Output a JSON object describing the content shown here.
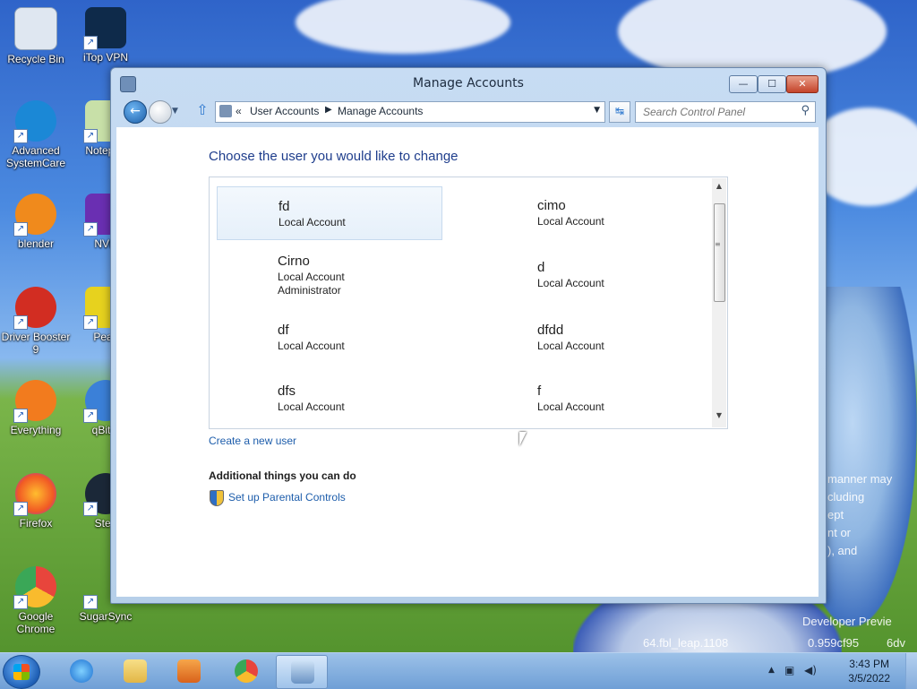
{
  "desktop": {
    "icons": [
      {
        "label": "Recycle Bin",
        "color": "#dfe7f1"
      },
      {
        "label": "iTop VPN",
        "color": "#1aa0c8"
      },
      {
        "label": "Advanced SystemCare",
        "color": "#1b88d6"
      },
      {
        "label": "Notepad",
        "color": "#c8e0a8"
      },
      {
        "label": "blender",
        "color": "#f08a1c"
      },
      {
        "label": "NVD",
        "color": "#6a2fb2"
      },
      {
        "label": "Driver Booster 9",
        "color": "#d22d22"
      },
      {
        "label": "Peaz",
        "color": "#e7d21e"
      },
      {
        "label": "Everything",
        "color": "#f27b1e"
      },
      {
        "label": "qBitto",
        "color": "#3b80d8"
      },
      {
        "label": "Firefox",
        "color": "#f15a24"
      },
      {
        "label": "Stea",
        "color": "#1b2838"
      },
      {
        "label": "Google Chrome",
        "color": "#e8453c"
      },
      {
        "label": "SugarSync",
        "color": "#4a9b2f"
      }
    ],
    "watermark": {
      "line1": "Developer Previe",
      "line2": "64.fbl_leap.1108",
      "line3": "0.959cf95",
      "line4": "6dv",
      "partial1": "manner may",
      "partial2": "cluding",
      "partial3": "ept",
      "partial4": "nt or",
      "partial5": "), and"
    }
  },
  "window": {
    "title": "Manage Accounts",
    "buttons": {
      "minimize": "—",
      "maximize": "☐",
      "close": "✕"
    },
    "nav": {
      "back_glyph": "←",
      "up_glyph": "⇧",
      "breadcrumb_prefix": "«",
      "crumbs": [
        "User Accounts",
        "Manage Accounts"
      ],
      "crumb_sep": "▶",
      "dropdown_glyph": "▼",
      "refresh_glyph": "↹",
      "search_placeholder": "Search Control Panel",
      "search_glyph": "⚲"
    },
    "content": {
      "heading": "Choose the user you would like to change",
      "users": [
        {
          "name": "fd",
          "type": "Local Account",
          "role": ""
        },
        {
          "name": "cimo",
          "type": "Local Account",
          "role": ""
        },
        {
          "name": "Cirno",
          "type": "Local Account",
          "role": "Administrator"
        },
        {
          "name": "d",
          "type": "Local Account",
          "role": ""
        },
        {
          "name": "df",
          "type": "Local Account",
          "role": ""
        },
        {
          "name": "dfdd",
          "type": "Local Account",
          "role": ""
        },
        {
          "name": "dfs",
          "type": "Local Account",
          "role": ""
        },
        {
          "name": "f",
          "type": "Local Account",
          "role": ""
        }
      ],
      "scroll_up": "▲",
      "scroll_down": "▼",
      "scroll_grip": "≡",
      "create_user_link": "Create a new user",
      "additional_heading": "Additional things you can do",
      "parental_link": "Set up Parental Controls"
    }
  },
  "taskbar": {
    "tray_arrow": "▲",
    "tray_network": "▣",
    "tray_volume": "◀)",
    "time": "3:43 PM",
    "date": "3/5/2022"
  }
}
